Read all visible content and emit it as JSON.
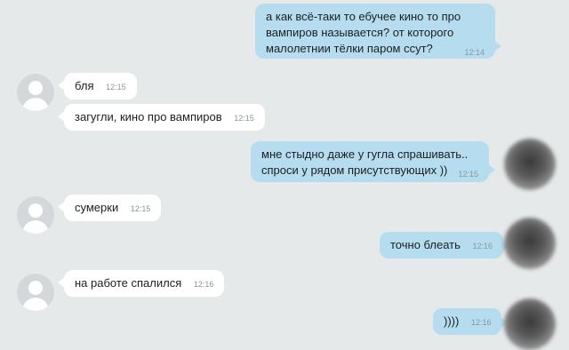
{
  "chat": {
    "messages": [
      {
        "text": "а как всё-таки то ебучее кино то про\nвампиров называется? от которого\nмалолетнии тёлки паром ссут?",
        "time": "12:14",
        "direction": "outgoing"
      },
      {
        "text": "бля",
        "time": "12:15",
        "direction": "incoming"
      },
      {
        "text": "загугли, кино про вампиров",
        "time": "12:15",
        "direction": "incoming"
      },
      {
        "text": "мне стыдно даже у гугла спрашивать..\nспроси у рядом присутствующих ))",
        "time": "12:15",
        "direction": "outgoing"
      },
      {
        "text": "сумерки",
        "time": "12:15",
        "direction": "incoming"
      },
      {
        "text": "точно блеать",
        "time": "12:16",
        "direction": "outgoing"
      },
      {
        "text": "на работе спалился",
        "time": "12:16",
        "direction": "incoming"
      },
      {
        "text": "))))",
        "time": "12:16",
        "direction": "outgoing"
      }
    ]
  },
  "colors": {
    "background": "#e6e9ea",
    "incoming_bubble": "#ffffff",
    "outgoing_bubble": "#b5dcef",
    "timestamp": "#8a969c"
  },
  "icons": {
    "incoming_avatar": "default-user-icon",
    "outgoing_avatar": "blurred-photo"
  }
}
